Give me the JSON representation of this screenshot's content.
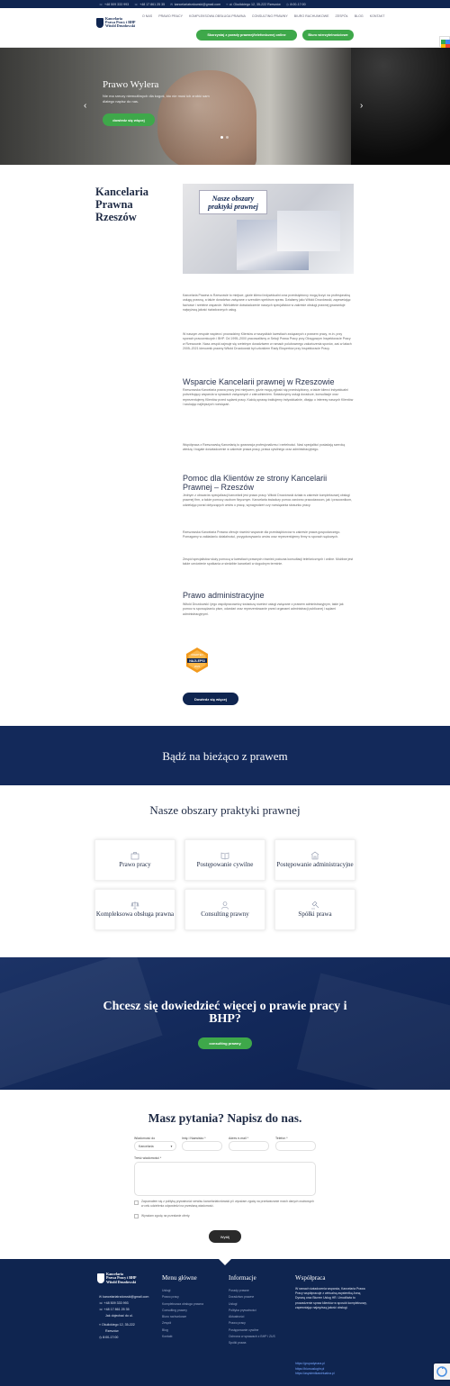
{
  "topbar": {
    "phone1": "+48 509 333 993",
    "phone2": "+48 17 861 25 35",
    "email": "kancelariatrzdowski@gmail.com",
    "address": "ul. Okulickiego 12, 35-222 Rzeszów",
    "hours": "8:00-17:00"
  },
  "header": {
    "logo_line1": "Kancelaria",
    "logo_line2": "Prawa Pracy i BHP",
    "logo_line3": "Witold Drozdowski",
    "nav": [
      "O NAS",
      "PRAWO PRACY",
      "KOMPLEKSOWA OBSŁUGA PRAWNA",
      "CONSULTING PRAWNY",
      "BIURO RACHUNKOWE",
      "ZESPÓŁ",
      "BLOG",
      "KONTAKT"
    ],
    "btn_consult": "Skorzystaj z porady prawnej/telefonicznej online",
    "btn_contact": "Biuro wierzytelnościowe"
  },
  "hero": {
    "title": "Prawo Wylera",
    "subtitle": "Nie ma rzeczy niemożliwych dla kogoś, kto nie musi ich zrobić sam dlatego napisz do nas.",
    "button": "dowiedz się więcej"
  },
  "about": {
    "title": "Kancelaria Prawna Rzeszów",
    "image_banner": "Nasze obszary praktyki prawnej",
    "p1": "Kancelaria Prawna w Rzeszowie to miejsce, gdzie klienci indywidualni oraz przedsiębiorcy mogą liczyć na profesjonalną usługę prawną, a także doradztwo związane z szerokim spektrum spraw. Działamy jako Witold Drozdowski, zapewniając fachowe i rzetelne wsparcie. Wieloletnie doświadczenie naszych specjalistów w zakresie obsługi prawnej gwarantuje najwyższą jakość świadczonych usług.",
    "p2": "W naszym zespole wspiera i prowadzimy Klientów w wszystkich kwestiach związanych z prawem pracy, m.in. przy sporach pracowniczych i BHP. Od 1995–2000 pracowaliśmy w Sekcji Prawa Pracy przy Okręgowym Inspektoracie Pracy w Rzeszowie. Nasz zespół zajmuje się rzetelnym doradztwem w ramach polubownego zakończenia sporów, zaś w latach 2005–2021 kierownik prawny Witold Drozdowski był członkiem Rady Ekspertów przy Inspektoracie Pracy.",
    "h_support": "Wsparcie Kancelarii prawnej w Rzeszowie",
    "p3": "Rzeszowska Kancelaria prawa pracy jest miejscem, gdzie mogą zgłosić się przedsiębiorcy, a także klienci indywidualni potrzebujący wsparcia w sprawach związanych z zatrudnieniem. Świadczymy usługi doradcze, konsultacje oraz reprezentujemy Klientów przed sądami pracy. Każdą sprawę traktujemy indywidualnie, dbając o interesy naszych Klientów i szukając najlepszych rozwiązań.",
    "p4": "Współpraca z Rzeszowską Kancelarią to gwarancja profesjonalizmu i rzetelności. Nasi specjaliści posiadają szeroką wiedzę i bogate doświadczenie w zakresie prawa pracy, prawa cywilnego oraz administracyjnego.",
    "h_help": "Pomoc dla Klientów ze strony Kancelarii Prawnej – Rzeszów",
    "p5": "Jednym z obszarów specjalizacji kancelarii jest prawo pracy. Witold Drozdowski działa w zakresie kompleksowej obsługi prawnej firm, a także pomocy osobom fizycznym. Kancelaria świadczy pomoc zarówno pracodawcom, jak i pracownikom, udzielając porad dotyczących umów o pracę, wynagrodzeń czy rozwiązania stosunku pracy.",
    "p6": "Rzeszowska Kancelaria Prawna oferuje również wsparcie dla przedsiębiorców w zakresie prawa gospodarczego. Pomagamy w zakładaniu działalności, przygotowywaniu umów oraz reprezentujemy firmy w sporach sądowych.",
    "p7": "Zespół specjalistów służy pomocą w kwestiach prawnych również podczas konsultacji telefonicznych i online. Możliwe jest także umówienie spotkania w siedzibie kancelarii w dogodnym terminie.",
    "h_admin": "Prawo administracyjne",
    "p8": "Witold Drozdowski i jego współpracownicy świadczą również usługi związane z prawem administracyjnym, takie jak pomoc w sporządzaniu pism, odwołań oraz reprezentowanie przed organami administracji publicznej i sądami administracyjnymi.",
    "badge_top": "OFERTEO",
    "badge_mid": "NAJLEPSI",
    "badge_year": "2023",
    "button": "Dowiedz się więcej"
  },
  "band": {
    "title": "Bądź na bieżąco z prawem"
  },
  "areas": {
    "title": "Nasze obszary praktyki prawnej",
    "items": [
      {
        "label": "Prawo pracy",
        "icon": "briefcase-icon"
      },
      {
        "label": "Postępowanie cywilne",
        "icon": "book-icon"
      },
      {
        "label": "Postępowanie administracyjne",
        "icon": "building-icon"
      },
      {
        "label": "Kompleksowa obsługa prawna",
        "icon": "scale-icon"
      },
      {
        "label": "Consulting prawny",
        "icon": "person-icon"
      },
      {
        "label": "Spółki prawa",
        "icon": "gavel-icon"
      }
    ]
  },
  "cta": {
    "title": "Chcesz się dowiedzieć więcej o prawie pracy i BHP?",
    "button": "consulting prawny"
  },
  "form": {
    "title": "Masz pytania? Napisz do nas.",
    "l_recipient": "Wiadomość do",
    "v_recipient": "Kancelaria",
    "l_name": "Imię i Nazwisko *",
    "l_email": "Adres e-mail *",
    "l_phone": "Telefon *",
    "l_message": "Treść wiadomości *",
    "consent1": "Zapoznałem się z polityką prywatności serwisu kancelariatrzdowski.pl i wyrażam zgodę na przetwarzanie moich danych osobowych w celu udzielenia odpowiedzi na przesłaną wiadomość.",
    "consent2": "Wyrażam zgodę na przesłanie oferty.",
    "send": "Wyślij"
  },
  "footer": {
    "logo_line1": "Kancelaria",
    "logo_line2": "Prawa Pracy i BHP",
    "logo_line3": "Witold Drozdowski",
    "email": "kancelariatrzdowski@gmail.com",
    "phone1": "+48 509 333 993",
    "phone2": "+48 17 861 25 35",
    "address1": "Jak dojechać do ul.",
    "address2": "Okulickiego 12, 35-222",
    "address3": "Rzeszów",
    "hours": "8:00-17:00",
    "menu_title": "Menu główne",
    "menu": [
      "Usługi",
      "Prawo pracy",
      "Kompleksowa obsługa prawna",
      "Consulting prawny",
      "Biuro rachunkowe",
      "Zespół",
      "Blog",
      "Kontakt"
    ],
    "info_title": "Informacje",
    "info": [
      "Porady prawne",
      "Doradztwo prawne",
      "Usługi",
      "Polityka prywatności",
      "Aktualności",
      "Prawo pracy",
      "Postępowanie cywilne",
      "Ochrona w sprawach z BHP i ZUS",
      "Spółki prawa"
    ],
    "coop_title": "Współpraca",
    "coop_text": "W ramach świadczenia wsparcia, Kancelaria Prawa Pracy współpracuje z wirtualną asystentką Anną Dynarą oraz Biurem Usług HR. Umożliwia to prowadzenie spraw klientów w sposób kompleksowy, zapewniając najwyższą jakość obsługi.",
    "coop_links": [
      "https://grupadynara.pl",
      "https://biurouslughr.pl",
      "https://asystentkawirtualna.pl"
    ]
  }
}
